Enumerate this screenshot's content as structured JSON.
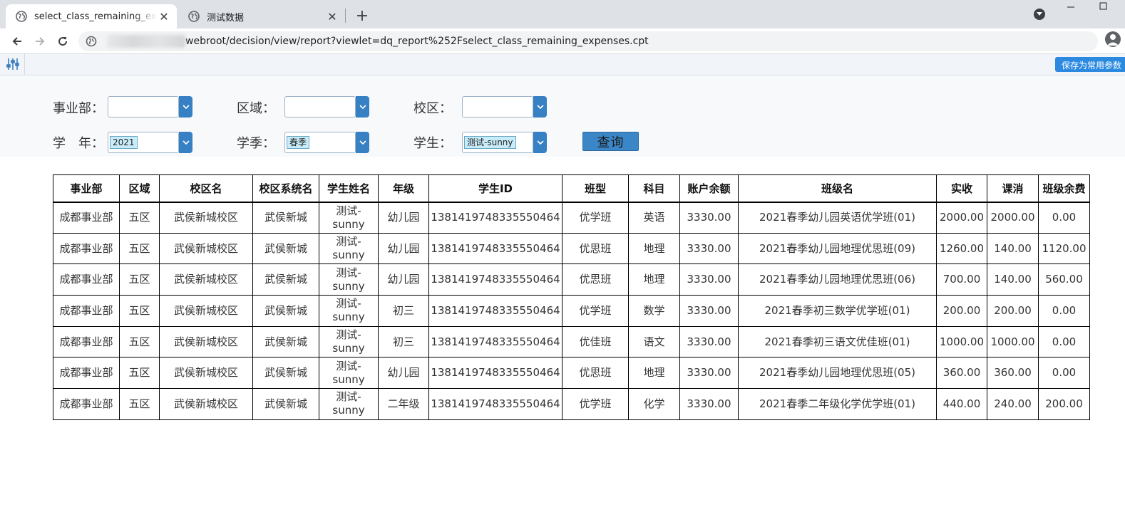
{
  "browser": {
    "tabs": [
      {
        "title": "select_class_remaining_expenses",
        "active": true
      },
      {
        "title": "测试数据",
        "active": false
      }
    ],
    "new_tab": "+",
    "close": "✕",
    "url": "webroot/decision/view/report?viewlet=dq_report%252Fselect_class_remaining_expenses.cpt"
  },
  "report_toolbar": {
    "save_params_label": "保存为常用参数"
  },
  "params": {
    "division_label": "事业部：",
    "division_value": "",
    "region_label": "区域：",
    "region_value": "",
    "campus_label": "校区：",
    "campus_value": "",
    "year_label": "学　年：",
    "year_value": "2021",
    "season_label": "学季：",
    "season_value": "春季",
    "student_label": "学生：",
    "student_value": "测试-sunny",
    "query_label": "查询"
  },
  "table": {
    "headers": [
      "事业部",
      "区域",
      "校区名",
      "校区系统名",
      "学生姓名",
      "年级",
      "学生ID",
      "班型",
      "科目",
      "账户余额",
      "班级名",
      "实收",
      "课消",
      "班级余费"
    ],
    "rows": [
      [
        "成都事业部",
        "五区",
        "武侯新城校区",
        "武侯新城",
        "测试-\nsunny",
        "幼儿园",
        "1381419748335550464",
        "优学班",
        "英语",
        "3330.00",
        "2021春季幼儿园英语优学班(01)",
        "2000.00",
        "2000.00",
        "0.00"
      ],
      [
        "成都事业部",
        "五区",
        "武侯新城校区",
        "武侯新城",
        "测试-\nsunny",
        "幼儿园",
        "1381419748335550464",
        "优思班",
        "地理",
        "3330.00",
        "2021春季幼儿园地理优思班(09)",
        "1260.00",
        "140.00",
        "1120.00"
      ],
      [
        "成都事业部",
        "五区",
        "武侯新城校区",
        "武侯新城",
        "测试-\nsunny",
        "幼儿园",
        "1381419748335550464",
        "优思班",
        "地理",
        "3330.00",
        "2021春季幼儿园地理优思班(06)",
        "700.00",
        "140.00",
        "560.00"
      ],
      [
        "成都事业部",
        "五区",
        "武侯新城校区",
        "武侯新城",
        "测试-\nsunny",
        "初三",
        "1381419748335550464",
        "优学班",
        "数学",
        "3330.00",
        "2021春季初三数学优学班(01)",
        "200.00",
        "200.00",
        "0.00"
      ],
      [
        "成都事业部",
        "五区",
        "武侯新城校区",
        "武侯新城",
        "测试-\nsunny",
        "初三",
        "1381419748335550464",
        "优佳班",
        "语文",
        "3330.00",
        "2021春季初三语文优佳班(01)",
        "1000.00",
        "1000.00",
        "0.00"
      ],
      [
        "成都事业部",
        "五区",
        "武侯新城校区",
        "武侯新城",
        "测试-\nsunny",
        "幼儿园",
        "1381419748335550464",
        "优思班",
        "地理",
        "3330.00",
        "2021春季幼儿园地理优思班(05)",
        "360.00",
        "360.00",
        "0.00"
      ],
      [
        "成都事业部",
        "五区",
        "武侯新城校区",
        "武侯新城",
        "测试-\nsunny",
        "二年级",
        "1381419748335550464",
        "优学班",
        "化学",
        "3330.00",
        "2021春季二年级化学优学班(01)",
        "440.00",
        "240.00",
        "200.00"
      ]
    ]
  }
}
